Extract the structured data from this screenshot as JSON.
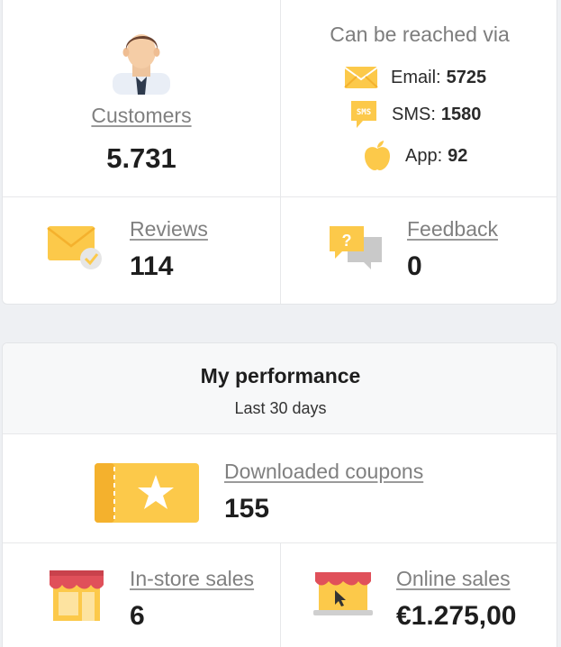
{
  "customers": {
    "label": "Customers",
    "value": "5.731"
  },
  "reach": {
    "title": "Can be reached via",
    "items": [
      {
        "label": "Email:",
        "value": "5725",
        "icon": "envelope-icon"
      },
      {
        "label": "SMS:",
        "value": "1580",
        "icon": "sms-bubble-icon",
        "badge": "SMS"
      },
      {
        "label": "App:",
        "value": "92",
        "icon": "apple-icon"
      }
    ]
  },
  "reviews": {
    "label": "Reviews",
    "value": "114"
  },
  "feedback": {
    "label": "Feedback",
    "value": "0"
  },
  "performance": {
    "title": "My performance",
    "subtitle": "Last 30 days",
    "coupons": {
      "label": "Downloaded coupons",
      "value": "155"
    },
    "instore": {
      "label": "In-store sales",
      "value": "6"
    },
    "online": {
      "label": "Online sales",
      "value": "€1.275,00"
    }
  },
  "colors": {
    "accent": "#fcc94a",
    "accent_dark": "#f4b12d",
    "link": "#808080",
    "awning_red": "#e0505a"
  }
}
